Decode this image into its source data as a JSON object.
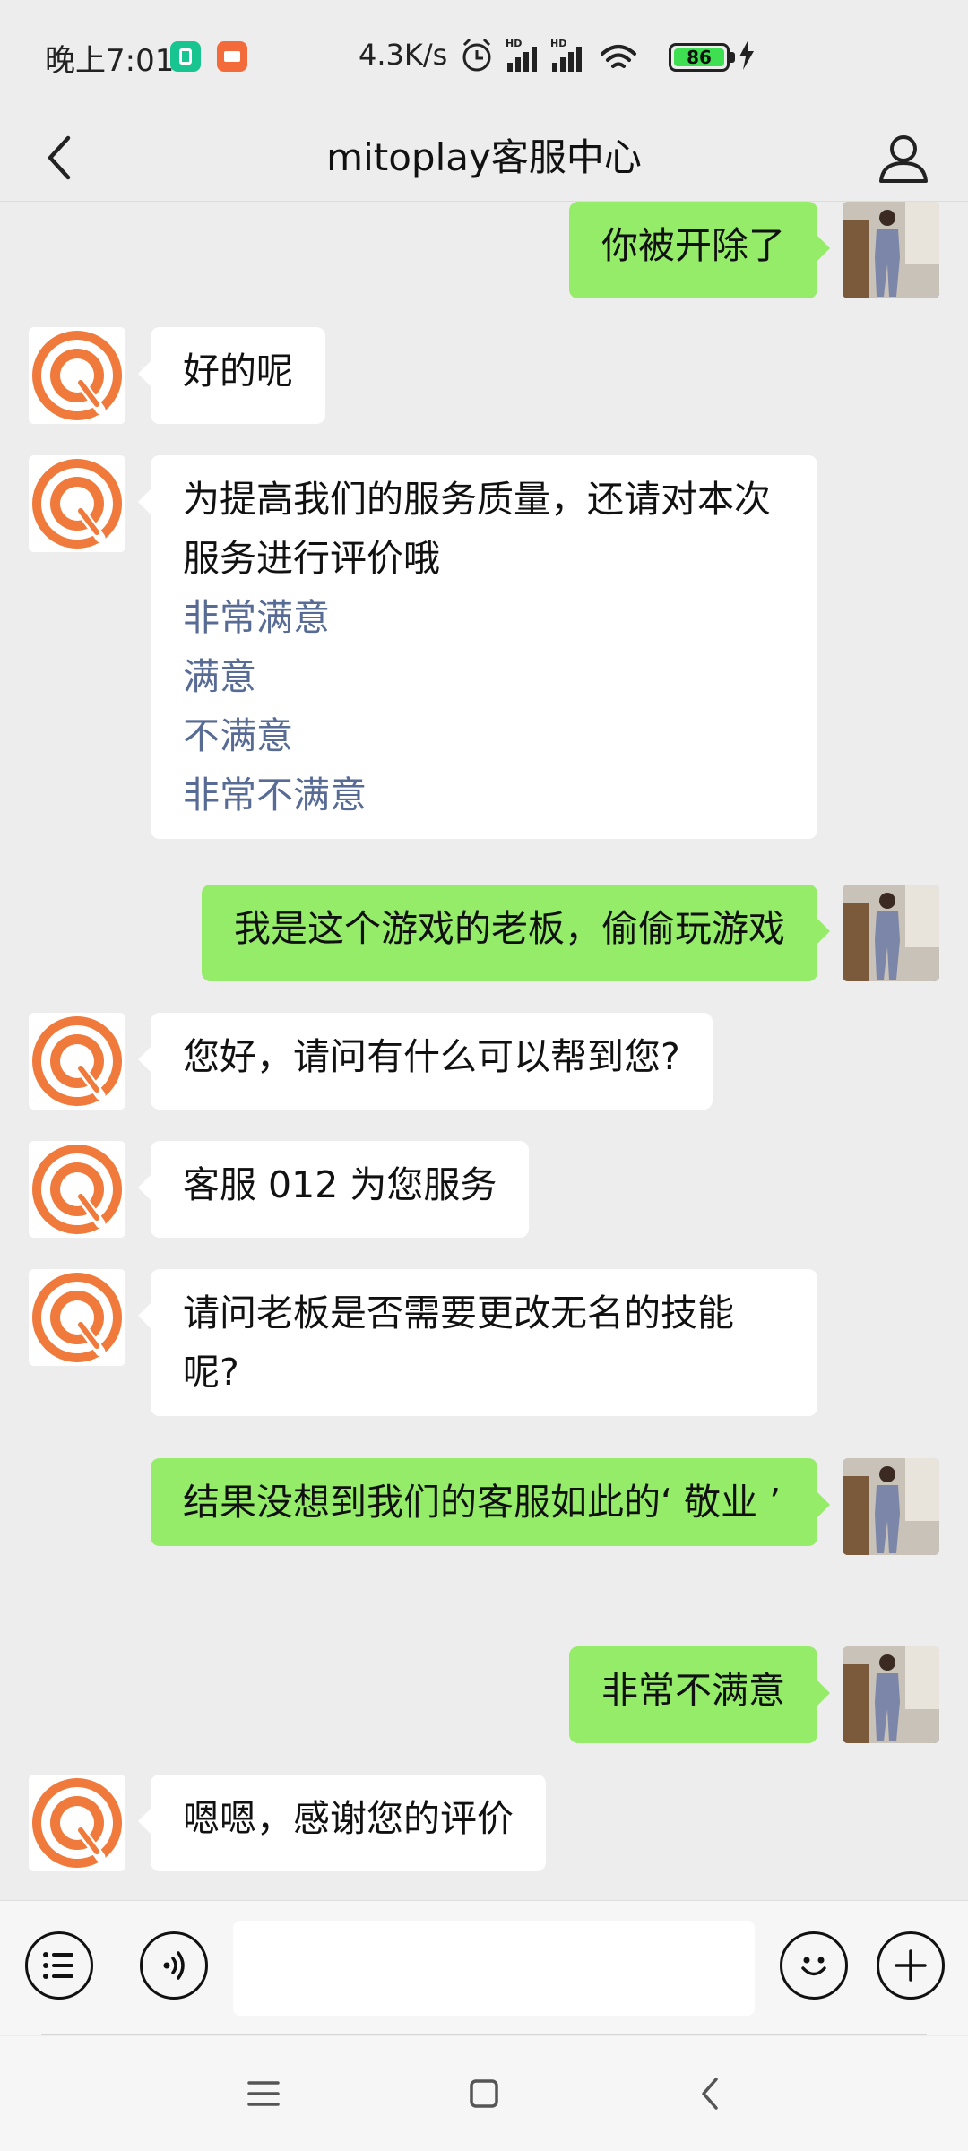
{
  "status_bar": {
    "time": "晚上7:01",
    "net_speed": "4.3K/s",
    "battery": "86"
  },
  "header": {
    "title": "mitoplay客服中心"
  },
  "messages": [
    {
      "side": "right",
      "text": "你被开除了"
    },
    {
      "side": "left",
      "text": "好的呢"
    },
    {
      "side": "left",
      "text": "为提高我们的服务质量，还请对本次服务进行评价哦",
      "options": [
        "非常满意",
        "满意",
        "不满意",
        "非常不满意"
      ]
    },
    {
      "side": "right",
      "text": "我是这个游戏的老板，偷偷玩游戏"
    },
    {
      "side": "left",
      "text": "您好，请问有什么可以帮到您?"
    },
    {
      "side": "left",
      "text": "客服 012 为您服务"
    },
    {
      "side": "left",
      "text": "请问老板是否需要更改无名的技能呢?"
    },
    {
      "side": "right",
      "text": "结果没想到我们的客服如此的‘ 敬业 ’"
    },
    {
      "side": "right",
      "text": "非常不满意"
    },
    {
      "side": "left",
      "text": "嗯嗯，感谢您的评价"
    }
  ],
  "colors": {
    "accent_green": "#95ec69",
    "link_blue": "#576b95",
    "bot_logo_orange": "#ef7a3c",
    "background": "#ededed"
  },
  "icons": [
    "back-arrow-icon",
    "profile-icon",
    "menu-list-icon",
    "voice-icon",
    "emoji-icon",
    "plus-icon"
  ]
}
